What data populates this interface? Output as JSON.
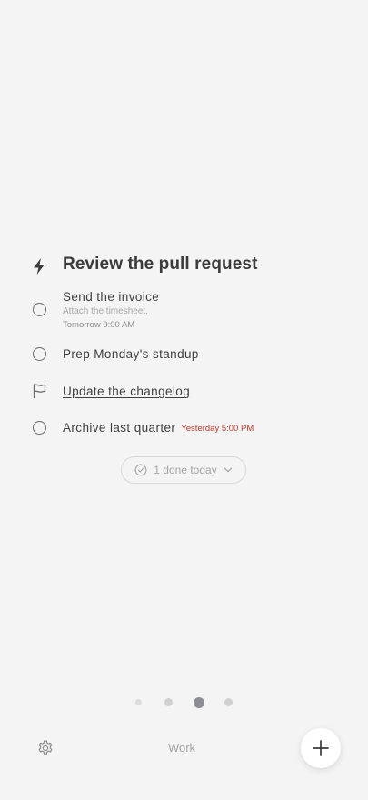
{
  "focus": {
    "icon": "lightning-bolt-icon",
    "title": "Review the pull request"
  },
  "tasks": [
    {
      "title": "Send the invoice",
      "note": "Attach the timesheet.",
      "due": "Tomorrow 9:00 AM",
      "marker": "circle-icon"
    },
    {
      "title": "Prep Monday's standup",
      "marker": "circle-icon"
    },
    {
      "title": "Update the changelog",
      "marker": "flag-icon"
    },
    {
      "title": "Archive last quarter",
      "due": "Yesterday 5:00 PM",
      "due_color": "#c0392b",
      "marker": "circle-icon"
    }
  ],
  "done_summary": {
    "label": "1 done today",
    "icon": "check-circle-icon",
    "chevron": "chevron-down-icon"
  },
  "pager": {
    "count": 4,
    "active_index": 2
  },
  "bottom_bar": {
    "settings_icon": "gear-icon",
    "list_name": "Work",
    "add_icon": "plus-icon"
  }
}
